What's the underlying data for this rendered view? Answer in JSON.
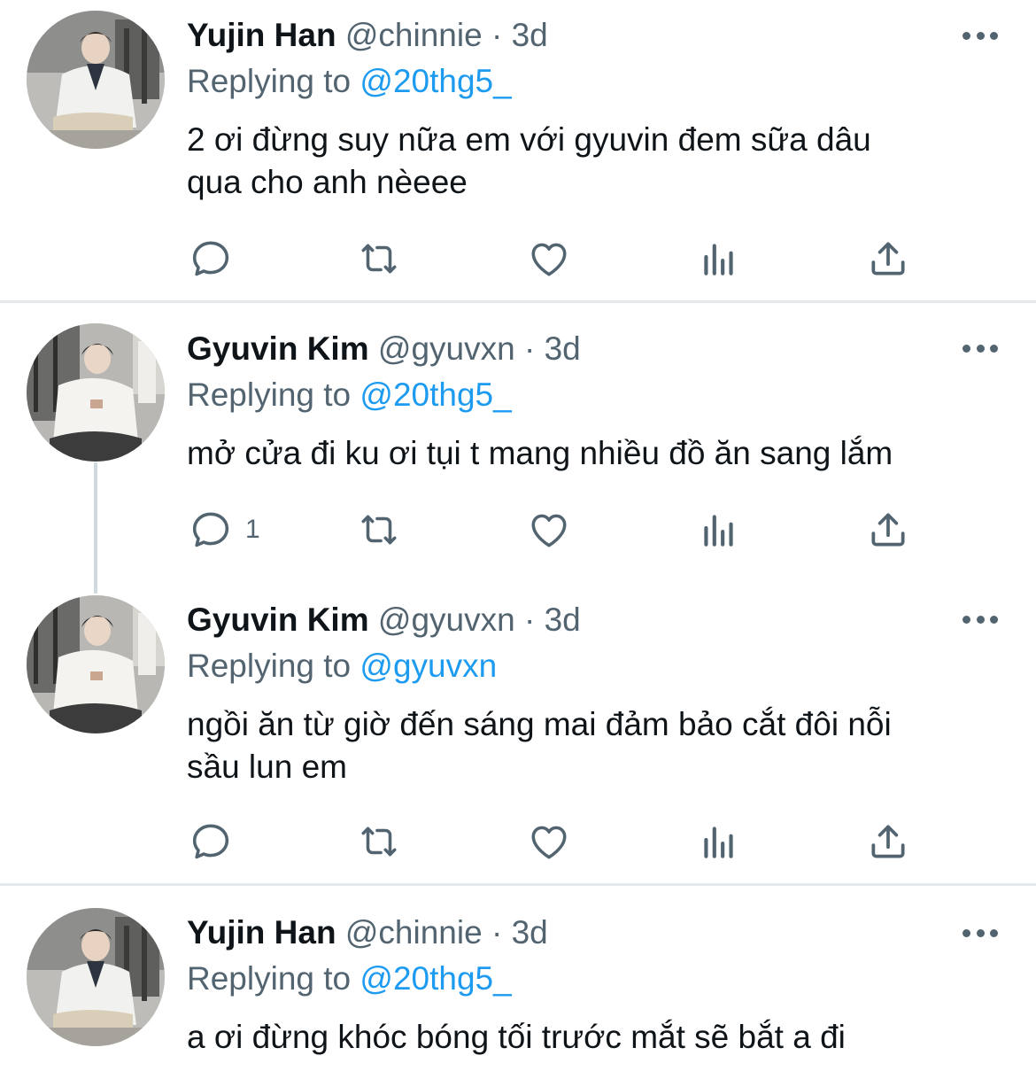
{
  "tweets": [
    {
      "name": "Yujin Han",
      "handle": "@chinnie",
      "sep": "·",
      "time": "3d",
      "replying_prefix": "Replying to",
      "replying_to": "@20thg5_",
      "text_lines": [
        "2 ơi đừng suy nữa em với gyuvin đem sữa dâu",
        "qua cho anh nèeee"
      ],
      "reply_count": "",
      "avatar": "yujin-avatar"
    },
    {
      "name": "Gyuvin Kim",
      "handle": "@gyuvxn",
      "sep": "·",
      "time": "3d",
      "replying_prefix": "Replying to",
      "replying_to": "@20thg5_",
      "text_lines": [
        "mở cửa đi ku ơi tụi t mang nhiều đồ ăn sang lắm"
      ],
      "reply_count": "1",
      "avatar": "gyuvin-avatar"
    },
    {
      "name": "Gyuvin Kim",
      "handle": "@gyuvxn",
      "sep": "·",
      "time": "3d",
      "replying_prefix": "Replying to",
      "replying_to": "@gyuvxn",
      "text_lines": [
        "ngồi ăn từ giờ đến sáng mai đảm bảo cắt đôi nỗi",
        "sầu lun em"
      ],
      "reply_count": "",
      "avatar": "gyuvin-avatar"
    },
    {
      "name": "Yujin Han",
      "handle": "@chinnie",
      "sep": "·",
      "time": "3d",
      "replying_prefix": "Replying to",
      "replying_to": "@20thg5_",
      "text_lines": [
        "a ơi đừng khóc bóng tối trước mắt sẽ bắt a đi"
      ],
      "reply_count": "",
      "avatar": "yujin-avatar"
    }
  ],
  "icons": {
    "reply": "reply-icon",
    "retweet": "retweet-icon",
    "like": "heart-icon",
    "analytics": "analytics-icon",
    "share": "share-icon",
    "more": "more-options-icon"
  },
  "colors": {
    "text": "#0f1419",
    "secondary": "#536471",
    "accent": "#1d9bf0",
    "divider": "#e6e9eb"
  }
}
